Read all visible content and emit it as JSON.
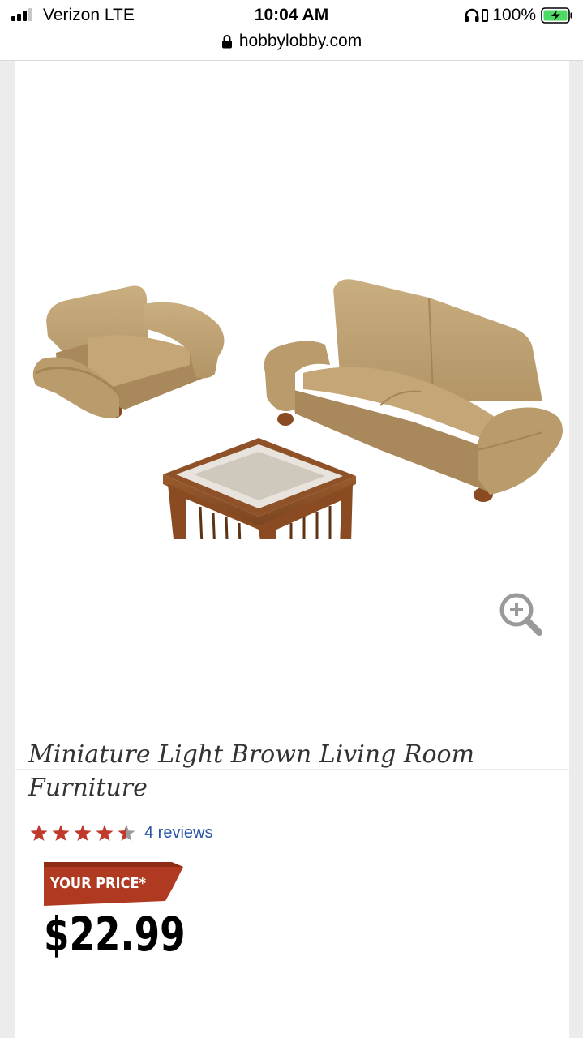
{
  "status_bar": {
    "carrier": "Verizon  LTE",
    "time": "10:04 AM",
    "battery_percent": "100%",
    "signal_bars": 3,
    "icons": [
      "signal-icon",
      "headphones-icon",
      "orientation-lock-icon",
      "battery-charging-icon"
    ]
  },
  "address_bar": {
    "url": "hobbylobby.com",
    "icon": "lock-icon"
  },
  "product": {
    "image_icon": "zoom-in-icon",
    "title": "Miniature Light Brown Living Room Furniture",
    "rating": 4.5,
    "rating_max": 5,
    "reviews_label": "4 reviews",
    "price_label": "YOUR PRICE*",
    "price": "$22.99"
  },
  "colors": {
    "star": "#c0392b",
    "price_banner": "#b03a21",
    "link": "#2a56a8",
    "battery": "#4cd964"
  }
}
